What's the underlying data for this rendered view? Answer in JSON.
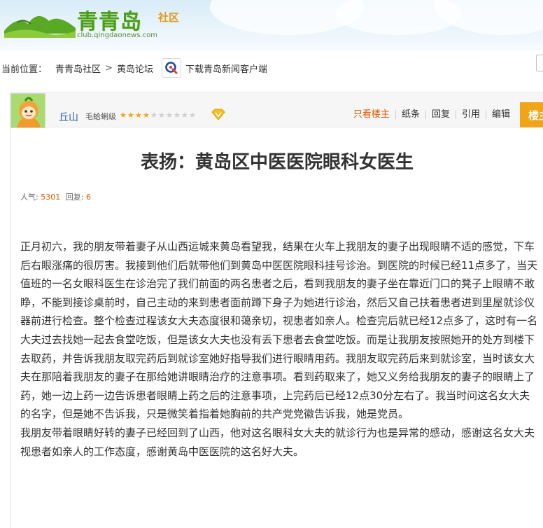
{
  "header": {
    "logo_text": "青青岛",
    "logo_sub": "社区",
    "logo_domain": "club.qingdaonews.com"
  },
  "breadcrumb": {
    "label": "当前位置：",
    "items": [
      "青青岛社区",
      "黄岛论坛"
    ],
    "separator": ">",
    "download_text": "下载青岛新闻客户端"
  },
  "author": {
    "name": "丘山",
    "rank": "毛蛤蜊级",
    "stars_on": 4,
    "stars_total": 10
  },
  "actions": [
    "只看楼主",
    "纸条",
    "回复",
    "引用",
    "编辑"
  ],
  "floor_label": "楼主",
  "post": {
    "title": "表扬：黄岛区中医医院眼科女医生",
    "views_label": "人气:",
    "views": "5301",
    "replies_label": "回复:",
    "replies": "6",
    "paragraphs": [
      "正月初六，我的朋友带着妻子从山西运城来黄岛看望我，结果在火车上我朋友的妻子出现眼睛不适的感觉，下车后右眼涨痛的很厉害。我接到他们后就带他们到黄岛中医医院眼科挂号诊治。到医院的时候已经11点多了，当天值班的一名女眼科医生在诊治完了我们前面的两名患者之后，看到我朋友的妻子坐在靠近门口的凳子上眼睛不敢睁，不能到接诊桌前时，自己主动的来到患者面前蹲下身子为她进行诊治，然后又自己扶着患者进到里屋就诊仪器前进行检查。整个检查过程该女大夫态度很和蔼亲切，视患者如亲人。检查完后就已经12点多了，这时有一名大夫过去找她一起去食堂吃饭，但是该女大夫也没有丢下患者去食堂吃饭。而是让我朋友按照她开的处方到楼下去取药，并告诉我朋友取完药后到就诊室她好指导我们进行眼睛用药。我朋友取完药后来到就诊室，当时该女大夫在那陪着我朋友的妻子在那给她讲眼睛治疗的注意事项。看到药取来了，她又义务给我朋友的妻子的眼睛上了药，她一边上药一边告诉患者眼睛上药之后的注意事项，上完药后已经12点30分左右了。我当时问这名女大夫的名字，但是她不告诉我，只是微笑着指着她胸前的共产党党徽告诉我，她是党员。",
      "我朋友带着眼睛好转的妻子已经回到了山西，他对这名眼科女大夫的就诊行为也是异常的感动，感谢这名女大夫视患者如亲人的工作态度，感谢黄岛中医医院的这名好大夫。"
    ]
  },
  "colors": {
    "brand_green": "#4a9e1c",
    "accent_orange": "#f0a418",
    "link_blue": "#1e5fa8",
    "highlight_orange": "#e05a00"
  }
}
